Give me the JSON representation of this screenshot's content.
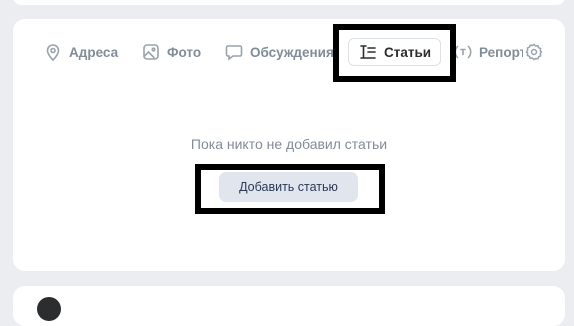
{
  "tabs": [
    {
      "label": "Адреса",
      "icon": "location-pin-icon"
    },
    {
      "label": "Фото",
      "icon": "photo-icon"
    },
    {
      "label": "Обсуждения",
      "icon": "speech-bubble-icon"
    },
    {
      "label": "Статьи",
      "icon": "article-icon",
      "active": true
    },
    {
      "label": "Репортажи",
      "icon": "broadcast-icon"
    }
  ],
  "settings_icon": "gear-icon",
  "empty_state": {
    "message": "Пока никто не добавил статьи",
    "button_label": "Добавить статью"
  },
  "colors": {
    "background": "#ebedf0",
    "card": "#ffffff",
    "muted_text": "#818c99",
    "button_bg": "#e1e6ee",
    "button_text": "#2a3a55",
    "highlight": "#000000"
  }
}
